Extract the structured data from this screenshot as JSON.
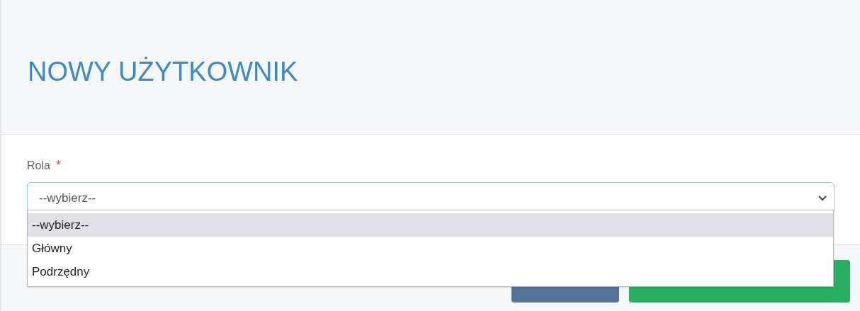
{
  "title": "NOWY UŻYTKOWNIK",
  "field": {
    "label": "Rola",
    "required_mark": "*",
    "value": "--wybierz--",
    "expanded": true,
    "options": [
      {
        "label": "--wybierz--",
        "selected": true
      },
      {
        "label": "Główny",
        "selected": false
      },
      {
        "label": "Podrzędny",
        "selected": false
      }
    ]
  },
  "buttons": [
    {
      "kind": "secondary"
    },
    {
      "kind": "primary"
    }
  ]
}
